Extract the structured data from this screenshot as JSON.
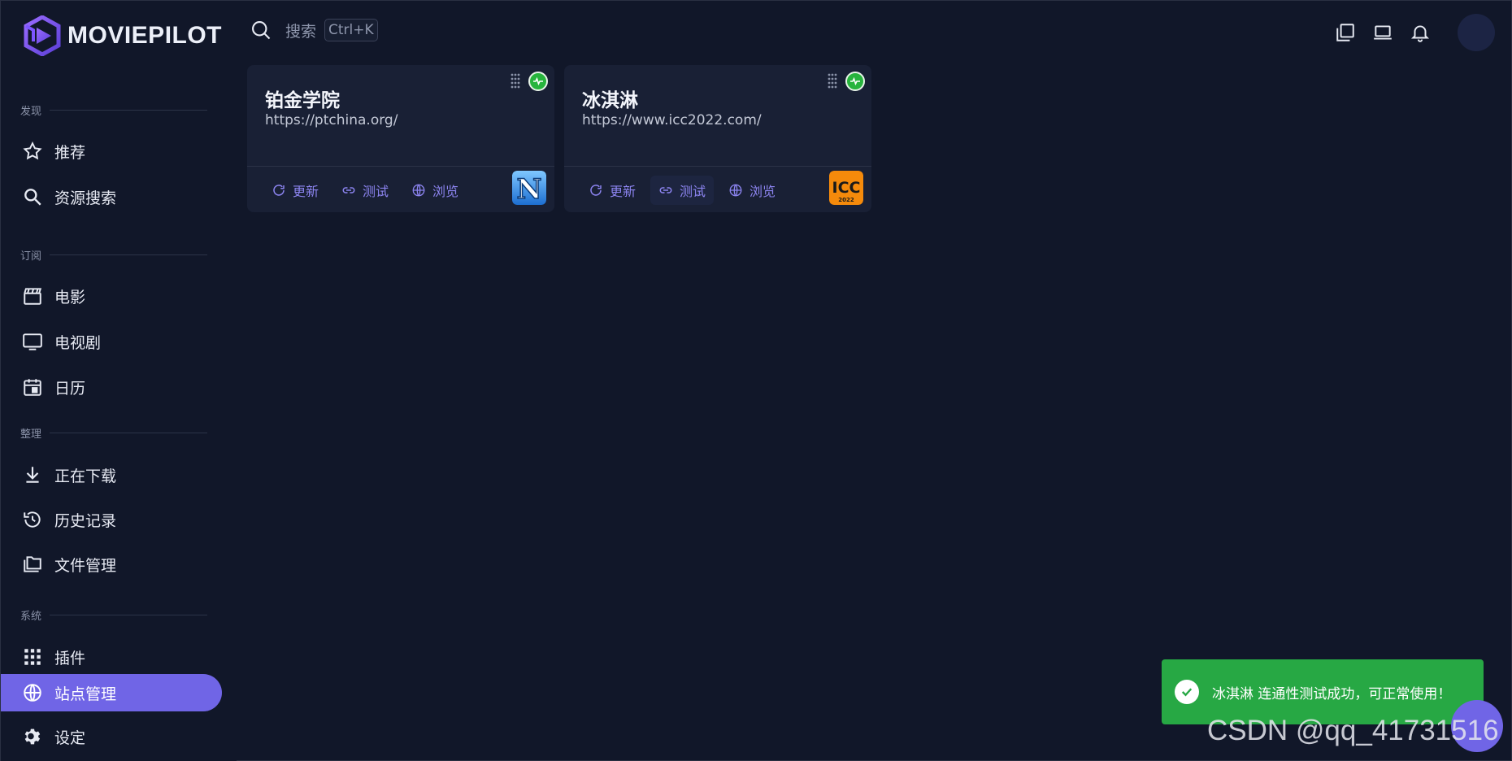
{
  "app": {
    "name": "MOVIEPILOT"
  },
  "colors": {
    "background": "#111729",
    "accent": "#7065e6",
    "card": "#192035",
    "success": "#27a844"
  },
  "sidebar": {
    "sections": [
      {
        "label": "发现",
        "items": [
          {
            "label": "推荐",
            "icon": "star-icon"
          },
          {
            "label": "资源搜索",
            "icon": "search-icon"
          }
        ]
      },
      {
        "label": "订阅",
        "items": [
          {
            "label": "电影",
            "icon": "clapperboard-icon"
          },
          {
            "label": "电视剧",
            "icon": "tv-icon"
          },
          {
            "label": "日历",
            "icon": "calendar-icon"
          }
        ]
      },
      {
        "label": "整理",
        "items": [
          {
            "label": "正在下载",
            "icon": "download-icon"
          },
          {
            "label": "历史记录",
            "icon": "history-icon"
          },
          {
            "label": "文件管理",
            "icon": "folders-icon"
          }
        ]
      },
      {
        "label": "系统",
        "items": [
          {
            "label": "插件",
            "icon": "apps-grid-icon"
          },
          {
            "label": "站点管理",
            "icon": "globe-icon",
            "active": true
          },
          {
            "label": "设定",
            "icon": "gear-icon"
          }
        ]
      }
    ]
  },
  "topbar": {
    "search_label": "搜索",
    "shortcut": "Ctrl+K"
  },
  "cards": [
    {
      "title": "铂金学院",
      "url": "https://ptchina.org/",
      "status": "online",
      "actions": [
        "更新",
        "测试",
        "浏览"
      ],
      "logo": "N"
    },
    {
      "title": "冰淇淋",
      "url": "https://www.icc2022.com/",
      "status": "online",
      "actions": [
        "更新",
        "测试",
        "浏览"
      ],
      "logo": "ICC",
      "logo_sub": "2022"
    }
  ],
  "toast": {
    "message": "冰淇淋 连通性测试成功，可正常使用！"
  },
  "watermark": "CSDN @qq_41731516"
}
